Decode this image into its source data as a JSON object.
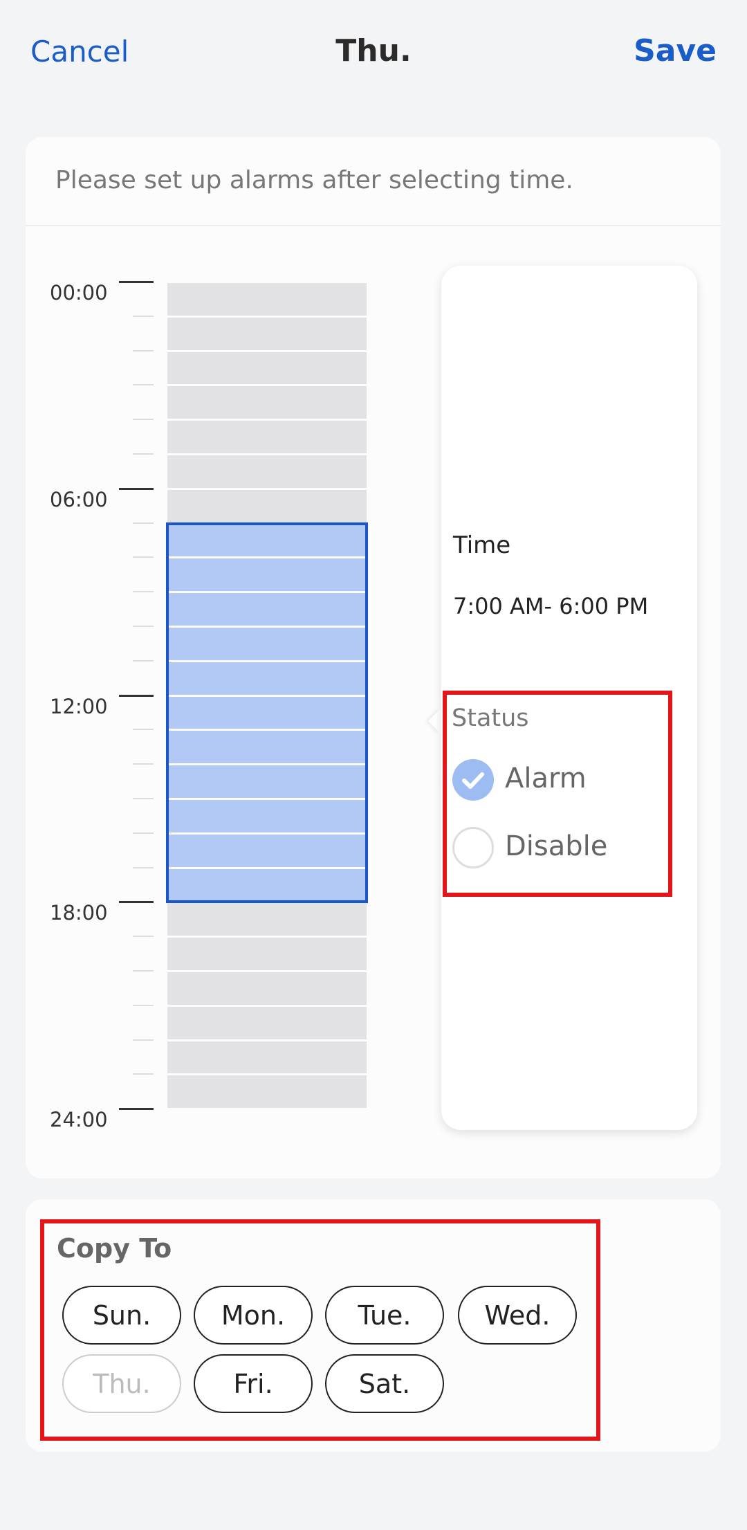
{
  "header": {
    "cancel": "Cancel",
    "title": "Thu.",
    "save": "Save"
  },
  "hint": "Please set up alarms after selecting time.",
  "timeline": {
    "labels": [
      "00:00",
      "06:00",
      "12:00",
      "18:00",
      "24:00"
    ],
    "selected_start_hour": 7,
    "selected_end_hour": 18,
    "colors": {
      "selected": "#b1c9f4",
      "unselected": "#e2e2e4",
      "border": "#1a56c8"
    }
  },
  "popup": {
    "time_label": "Time",
    "time_value": "7:00 AM- 6:00 PM",
    "status_label": "Status",
    "options": [
      {
        "label": "Alarm",
        "checked": true
      },
      {
        "label": "Disable",
        "checked": false
      }
    ]
  },
  "copy_to": {
    "title": "Copy To",
    "days": [
      {
        "label": "Sun.",
        "disabled": false
      },
      {
        "label": "Mon.",
        "disabled": false
      },
      {
        "label": "Tue.",
        "disabled": false
      },
      {
        "label": "Wed.",
        "disabled": false
      },
      {
        "label": "Thu.",
        "disabled": true
      },
      {
        "label": "Fri.",
        "disabled": false
      },
      {
        "label": "Sat.",
        "disabled": false
      }
    ]
  }
}
